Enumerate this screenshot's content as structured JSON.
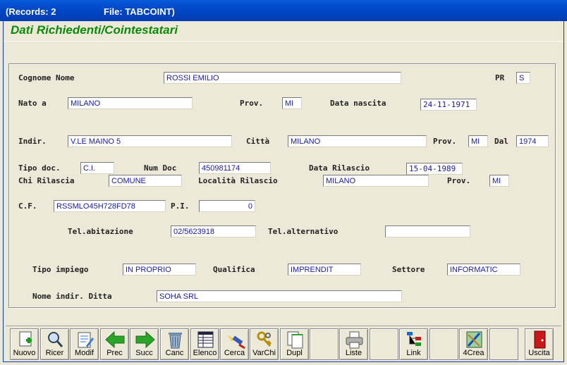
{
  "titlebar": {
    "records": "(Records: 2",
    "file": "File: TABCOINT)"
  },
  "form_title": "Dati Richiedenti/Cointestatari",
  "labels": {
    "cognome_nome": "Cognome Nome",
    "pr": "PR",
    "nato_a": "Nato a",
    "prov": "Prov.",
    "data_nascita": "Data nascita",
    "indir": "Indir.",
    "citta": "Città",
    "dal": "Dal",
    "tipo_doc": "Tipo doc.",
    "num_doc": "Num Doc",
    "data_rilascio": "Data Rilascio",
    "chi_rilascia": "Chi Rilascia",
    "localita_rilascio": "Località Rilascio",
    "cf": "C.F.",
    "pi": "P.I.",
    "tel_abitazione": "Tel.abitazione",
    "tel_alternativo": "Tel.alternativo",
    "tipo_impiego": "Tipo impiego",
    "qualifica": "Qualifica",
    "settore": "Settore",
    "nome_indir_ditta": "Nome indir. Ditta"
  },
  "fields": {
    "cognome_nome": "ROSSI EMILIO",
    "pr": "S",
    "nato_a": "MILANO",
    "prov_nascita": "MI",
    "data_nascita": "24-11-1971",
    "indir": "V.LE MAINO 5",
    "citta": "MILANO",
    "prov_citta": "MI",
    "dal": "1974",
    "tipo_doc": "C.I.",
    "num_doc": "450981174",
    "data_rilascio": "15-04-1989",
    "chi_rilascia": "COMUNE",
    "localita_rilascio": "MILANO",
    "prov_rilascio": "MI",
    "cf": "RSSMLO45H728FD78",
    "pi": "0",
    "tel_abitazione": "02/5623918",
    "tel_alternativo": "",
    "tipo_impiego": "IN PROPRIO",
    "qualifica": "IMPRENDIT",
    "settore": "INFORMATIC",
    "nome_indir_ditta": "SOHA SRL"
  },
  "toolbar": {
    "nuovo": "Nuovo",
    "ricer": "Ricer",
    "modif": "Modif",
    "prec": "Prec",
    "succ": "Succ",
    "canc": "Canc",
    "elenco": "Elenco",
    "cerca": "Cerca",
    "varchi": "VarChi",
    "dupl": "Dupl",
    "liste": "Liste",
    "link": "Link",
    "crea4": "4Crea",
    "uscita": "Uscita"
  }
}
